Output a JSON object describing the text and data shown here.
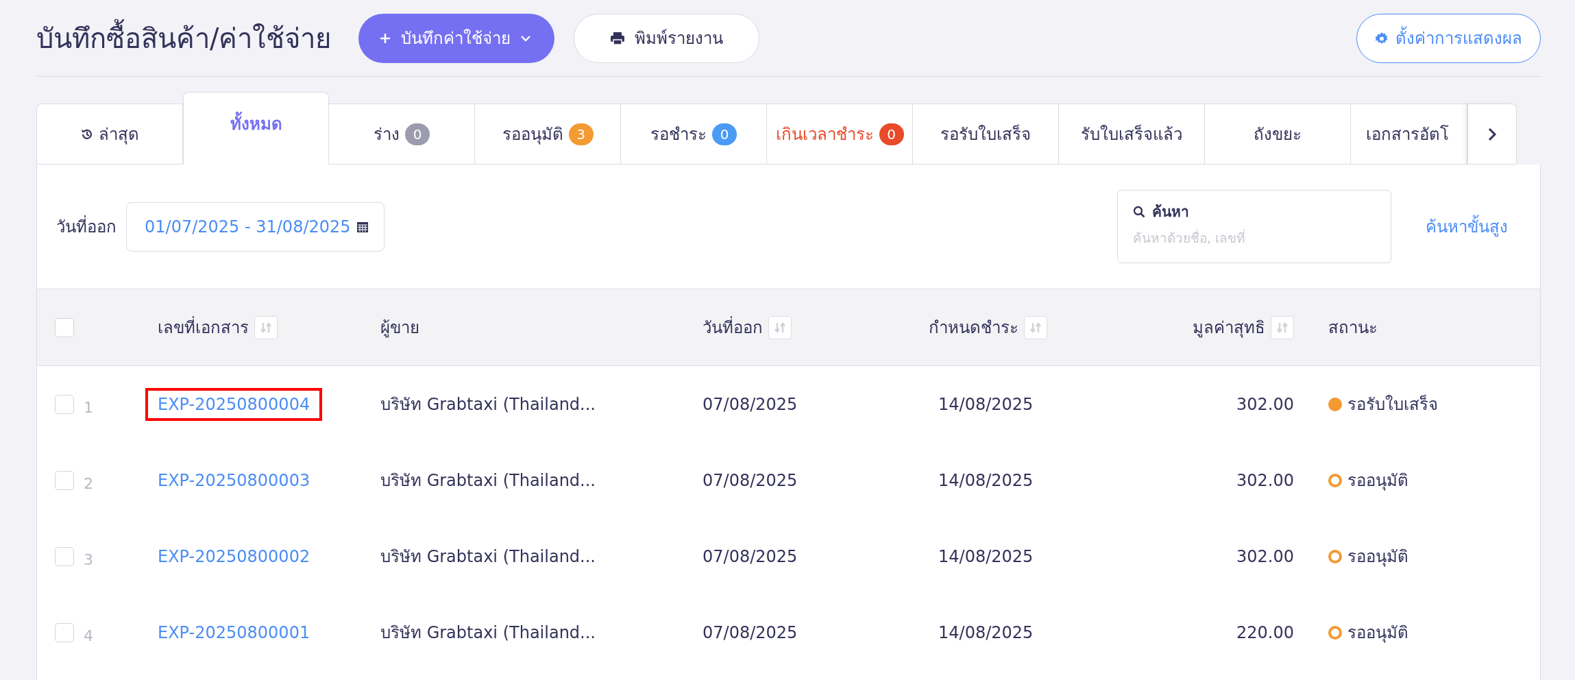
{
  "page": {
    "title": "บันทึกซื้อสินค้า/ค่าใช้จ่าย",
    "add_button": "บันทึกค่าใช้จ่าย",
    "print_button": "พิมพ์รายงาน",
    "settings_button": "ตั้งค่าการแสดงผล"
  },
  "tabs": [
    {
      "label": "ล่าสุด",
      "kind": "history",
      "selected": false
    },
    {
      "label": "ทั้งหมด",
      "kind": "plain",
      "selected": true
    },
    {
      "label": "ร่าง",
      "kind": "count",
      "badge": "0",
      "color": "#9c9cae",
      "selected": false
    },
    {
      "label": "รออนุมัติ",
      "kind": "count",
      "badge": "3",
      "color": "#f39a32",
      "selected": false
    },
    {
      "label": "รอชำระ",
      "kind": "count",
      "badge": "0",
      "color": "#4b9bf5",
      "selected": false
    },
    {
      "label": "เกินเวลาชำระ",
      "kind": "alert",
      "badge": "0",
      "color": "#e84a2a",
      "selected": false
    },
    {
      "label": "รอรับใบเสร็จ",
      "kind": "plain",
      "selected": false
    },
    {
      "label": "รับใบเสร็จแล้ว",
      "kind": "plain",
      "selected": false
    },
    {
      "label": "ถังขยะ",
      "kind": "plain",
      "selected": false
    },
    {
      "label": "เอกสารอัตโ",
      "kind": "plain",
      "selected": false
    }
  ],
  "filter": {
    "date_label": "วันที่ออก",
    "date_range": "01/07/2025 - 31/08/2025",
    "search_label": "ค้นหา",
    "search_placeholder": "ค้นหาด้วยชื่อ, เลขที่",
    "advanced_link": "ค้นหาขั้นสูง"
  },
  "table": {
    "select_all_checked": false,
    "columns": [
      {
        "label": "เลขที่เอกสาร",
        "sortable": true
      },
      {
        "label": "ผู้ขาย",
        "sortable": false
      },
      {
        "label": "วันที่ออก",
        "sortable": true
      },
      {
        "label": "กำหนดชำระ",
        "sortable": true
      },
      {
        "label": "มูลค่าสุทธิ",
        "sortable": true
      },
      {
        "label": "สถานะ",
        "sortable": false
      }
    ],
    "rows": [
      {
        "number": "1",
        "checked": false,
        "highlighted": true,
        "doc_no": "EXP-20250800004",
        "vendor": "บริษัท Grabtaxi (Thailand...",
        "issue_date": "07/08/2025",
        "due_date": "14/08/2025",
        "amount": "302.00",
        "status": "รอรับใบเสร็จ",
        "kind": "filled",
        "color": "#f39a32"
      },
      {
        "number": "2",
        "checked": false,
        "highlighted": false,
        "doc_no": "EXP-20250800003",
        "vendor": "บริษัท Grabtaxi (Thailand...",
        "issue_date": "07/08/2025",
        "due_date": "14/08/2025",
        "amount": "302.00",
        "status": "รออนุมัติ",
        "kind": "ring",
        "color": "#f39a32"
      },
      {
        "number": "3",
        "checked": false,
        "highlighted": false,
        "doc_no": "EXP-20250800002",
        "vendor": "บริษัท Grabtaxi (Thailand...",
        "issue_date": "07/08/2025",
        "due_date": "14/08/2025",
        "amount": "302.00",
        "status": "รออนุมัติ",
        "kind": "ring",
        "color": "#f39a32"
      },
      {
        "number": "4",
        "checked": false,
        "highlighted": false,
        "doc_no": "EXP-20250800001",
        "vendor": "บริษัท Grabtaxi (Thailand...",
        "issue_date": "07/08/2025",
        "due_date": "14/08/2025",
        "amount": "220.00",
        "status": "รออนุมัติ",
        "kind": "ring",
        "color": "#f39a32"
      }
    ]
  }
}
